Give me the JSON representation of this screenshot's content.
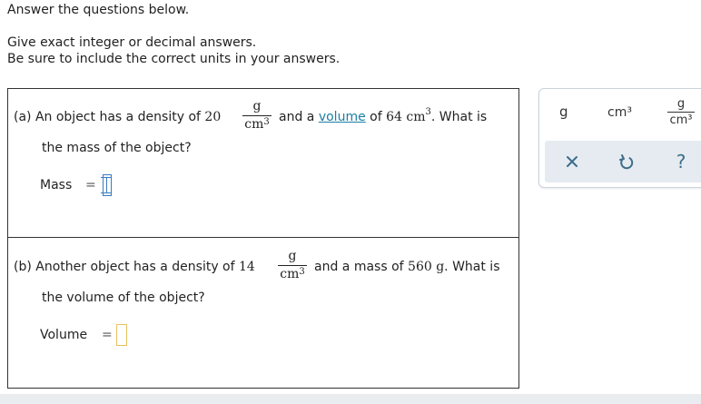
{
  "instructions": {
    "line1": "Answer the questions below.",
    "line2": "Give exact integer or decimal answers.",
    "line3": "Be sure to include the correct units in your answers."
  },
  "question_a": {
    "prefix": "(a)  An object has a density of",
    "density_value": "20",
    "density_num": "g",
    "density_den": "cm",
    "density_den_exp": "3",
    "middle_text": "and a",
    "link_text": "volume",
    "of_text": "of",
    "volume_value": "64 cm",
    "volume_exp": "3",
    "suffix": ". What is",
    "line2": "the mass of the object?",
    "answer_label": "Mass",
    "equals": "=",
    "answer_value": ""
  },
  "question_b": {
    "prefix": "(b)  Another object has a density of",
    "density_value": "14",
    "density_num": "g",
    "density_den": "cm",
    "density_den_exp": "3",
    "middle_text": "and a mass of",
    "mass_value": "560 g",
    "suffix": ". What is",
    "line2": "the volume of the object?",
    "answer_label": "Volume",
    "equals": "=",
    "answer_value": ""
  },
  "toolbox": {
    "unit_g": "g",
    "unit_cm3": "cm³",
    "unit_gcm3_num": "g",
    "unit_gcm3_den": "cm³",
    "icons": [
      "close-icon",
      "undo-icon",
      "help-icon"
    ]
  },
  "colors": {
    "link": "#1a7ea6",
    "input_border": "#3a7bbf",
    "toolbox_row2_bg": "#e5ebf0",
    "toolbox_icon": "#3d6e8c"
  }
}
